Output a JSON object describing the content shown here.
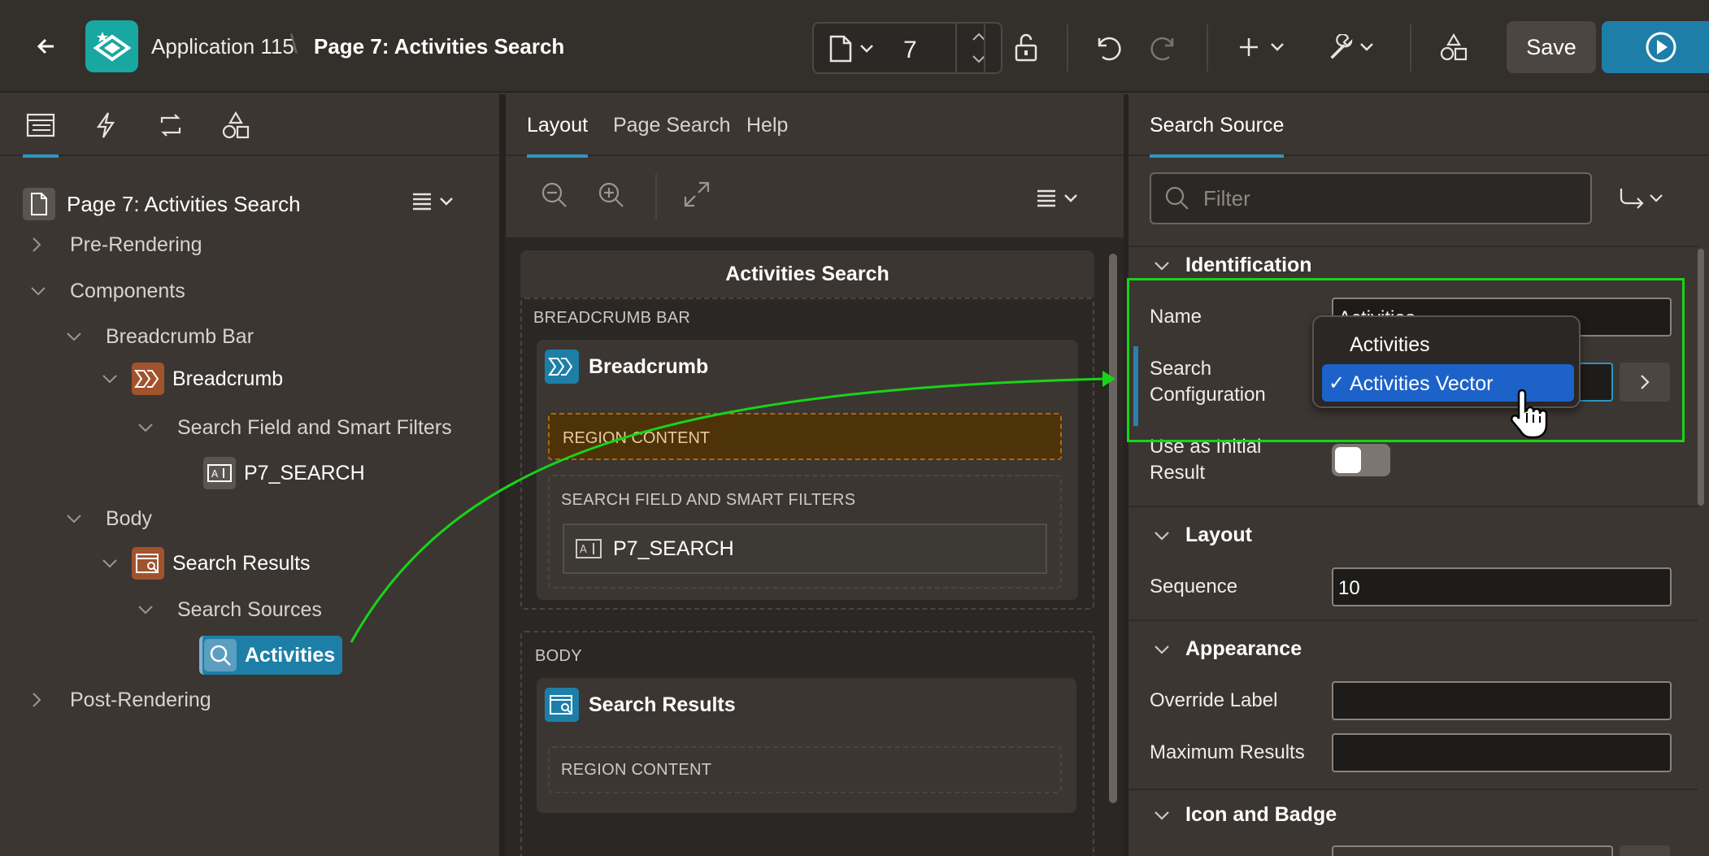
{
  "header": {
    "app_name": "Application 115",
    "breadcrumb_separator": "\\",
    "page_title": "Page 7: Activities Search",
    "page_number": "7",
    "save_label": "Save",
    "accent_color": "#1d7fa8",
    "logo_color": "#19a7a1"
  },
  "left": {
    "tree_root": "Page 7: Activities Search",
    "nodes": {
      "pre_rendering": "Pre-Rendering",
      "components": "Components",
      "breadcrumb_bar": "Breadcrumb Bar",
      "breadcrumb": "Breadcrumb",
      "search_field": "Search Field and Smart Filters",
      "p7_search": "P7_SEARCH",
      "body": "Body",
      "search_results": "Search Results",
      "search_sources": "Search Sources",
      "activities": "Activities",
      "post_rendering": "Post-Rendering"
    }
  },
  "center": {
    "tabs": [
      "Layout",
      "Page Search",
      "Help"
    ],
    "page_region_title": "Activities Search",
    "breadcrumb_bar_label": "BREADCRUMB BAR",
    "breadcrumb_region": "Breadcrumb",
    "region_content": "REGION CONTENT",
    "search_field_label": "SEARCH FIELD AND SMART FILTERS",
    "p7_search": "P7_SEARCH",
    "body_label": "BODY",
    "search_results_region": "Search Results",
    "region_content_2": "REGION CONTENT"
  },
  "right": {
    "tab": "Search Source",
    "filter_placeholder": "Filter",
    "groups": {
      "identification": "Identification",
      "layout": "Layout",
      "appearance": "Appearance",
      "icon_badge": "Icon and Badge"
    },
    "props": {
      "name_label": "Name",
      "name_value": "Activities",
      "search_config_label_1": "Search",
      "search_config_label_2": "Configuration",
      "initial_result_label_1": "Use as Initial",
      "initial_result_label_2": "Result",
      "initial_result_on": false,
      "sequence_label": "Sequence",
      "sequence_value": "10",
      "override_label": "Override Label",
      "max_results_label": "Maximum Results"
    },
    "dropdown": {
      "options": [
        "Activities",
        "Activities Vector"
      ],
      "selected": "Activities Vector",
      "check": "✓"
    }
  }
}
